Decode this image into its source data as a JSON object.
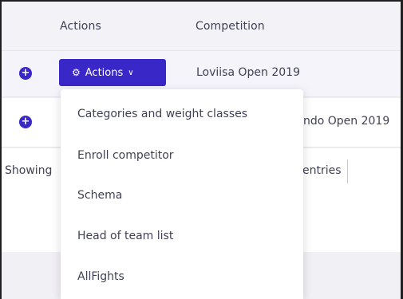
{
  "table": {
    "columns": [
      "Actions",
      "Competition"
    ],
    "rows": [
      {
        "action_label": "Actions",
        "competition": "Loviisa Open 2019"
      },
      {
        "competition_partial": "ndo Open 2019"
      }
    ],
    "footer": {
      "showing_partial": "Showing",
      "entries_partial": "entries"
    }
  },
  "dropdown": {
    "items": [
      "Categories and weight classes",
      "Enroll competitor",
      "Schema",
      "Head of team list",
      "AllFights"
    ]
  },
  "colors": {
    "primary": "#3a27c7",
    "text": "#3f4254",
    "header_bg": "#f3f3f7"
  },
  "icons": [
    "plus-circle-icon",
    "gear-icon",
    "chevron-down-icon"
  ]
}
